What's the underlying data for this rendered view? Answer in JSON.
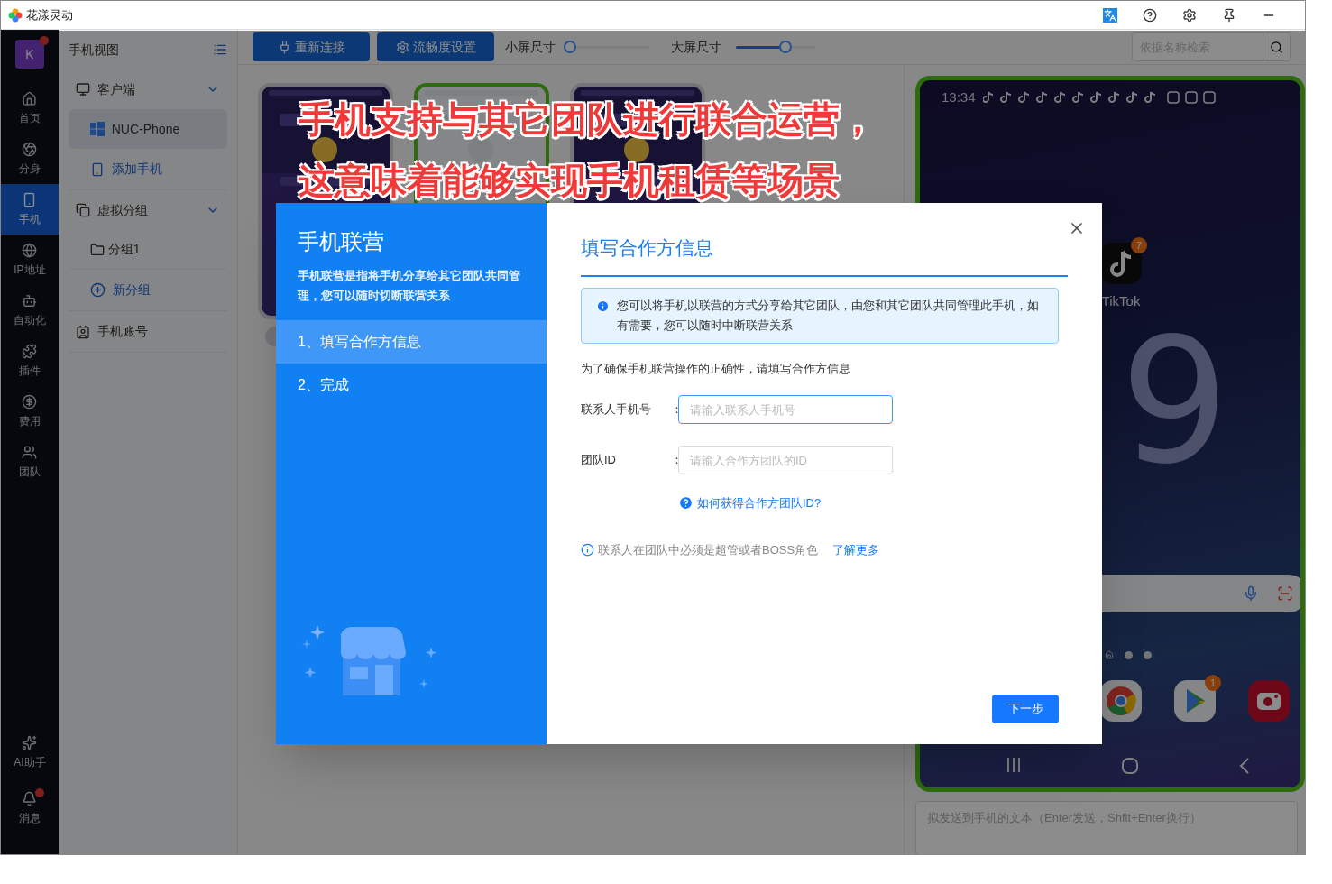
{
  "window": {
    "title": "花漾灵动"
  },
  "nav": {
    "avatar": "K",
    "avatar_badge": true,
    "items": [
      {
        "label": "首页",
        "selected": false
      },
      {
        "label": "分身",
        "selected": false
      },
      {
        "label": "手机",
        "selected": true
      },
      {
        "label": "IP地址",
        "selected": false
      },
      {
        "label": "自动化",
        "selected": false
      },
      {
        "label": "插件",
        "selected": false
      },
      {
        "label": "费用",
        "selected": false
      },
      {
        "label": "团队",
        "selected": false
      }
    ],
    "bottom_items": [
      {
        "label": "AI助手",
        "badge": false
      },
      {
        "label": "消息",
        "badge": true
      }
    ]
  },
  "sidebar": {
    "title": "手机视图",
    "tree": [
      {
        "label": "客户端",
        "kind": "group",
        "expanded": true,
        "children": [
          {
            "label": "NUC-Phone",
            "kind": "device",
            "selected": true
          },
          {
            "label": "添加手机",
            "kind": "action"
          }
        ]
      },
      {
        "label": "虚拟分组",
        "kind": "group",
        "expanded": true,
        "children": [
          {
            "label": "分组1",
            "kind": "folder",
            "selected": false
          },
          {
            "label": "新分组",
            "kind": "action"
          }
        ]
      },
      {
        "label": "手机账号",
        "kind": "account"
      }
    ]
  },
  "toolbar": {
    "buttons": [
      "重新连接",
      "流畅度设置"
    ],
    "sliders": [
      {
        "label": "小屏尺寸",
        "level": 0
      },
      {
        "label": "大屏尺寸",
        "level": 0.63
      }
    ],
    "search": {
      "placeholder": "依据名称检索"
    }
  },
  "phone_grid": [
    {
      "kind": "picture",
      "selected": false
    },
    {
      "kind": "picture",
      "selected": true
    },
    {
      "kind": "picture",
      "selected": false
    }
  ],
  "phone_screen": {
    "selected": true,
    "time": "13:34",
    "app": {
      "label": "TikTok",
      "badge": "7"
    },
    "clock": "9",
    "dock": [
      {
        "kind": "browser"
      },
      {
        "kind": "store",
        "badge": "1"
      },
      {
        "kind": "camera"
      }
    ]
  },
  "message_field": {
    "placeholder": "拟发送到手机的文本（Enter发送，Shfit+Enter换行）"
  },
  "caption_lines": [
    "手机支持与其它团队进行联合运营，",
    "这意味着能够实现手机租赁等场景"
  ],
  "dialog": {
    "side_title": "手机联营",
    "side_text": "手机联营是指将手机分享给其它团队共同管理，您可以随时切断联营关系",
    "steps": [
      {
        "label": "1、填写合作方信息",
        "selected": true
      },
      {
        "label": "2、完成",
        "selected": false
      }
    ],
    "title": "填写合作方信息",
    "alert": "您可以将手机以联营的方式分享给其它团队，由您和其它团队共同管理此手机，如有需要，您可以随时中断联营关系",
    "intro": "为了确保手机联营操作的正确性，请填写合作方信息",
    "fields": [
      {
        "label": "联系人手机号",
        "placeholder": "请输入联系人手机号",
        "focused": true
      },
      {
        "label": "团队ID",
        "placeholder": "请输入合作方团队的ID",
        "focused": false
      }
    ],
    "colon": "：",
    "help_link": "如何获得合作方团队ID?",
    "note": "联系人在团队中必须是超管或者BOSS角色",
    "note_link": "了解更多",
    "next_button": "下一步"
  }
}
